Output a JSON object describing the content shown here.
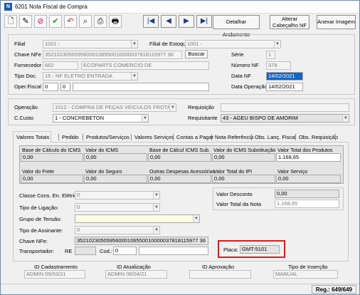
{
  "window": {
    "title": "6201 Nota Fiscal de Compra",
    "icon": "app-icon"
  },
  "toolbar": {
    "icons": [
      "new-icon",
      "edit-icon",
      "cancel-icon",
      "confirm-icon",
      "undo-icon",
      "search-icon",
      "print-icon",
      "printer-icon"
    ],
    "nav": [
      "first",
      "prev",
      "next",
      "last"
    ],
    "detail_label": "Detalhar Andamento",
    "alter_label": "Alterar Cabeçalho NF",
    "image_label": "Anexar Imagem"
  },
  "header": {
    "filial_label": "Filial",
    "filial_value": "1001 -",
    "filial_estoque_label": "Filial de Estoque",
    "filial_estoque_value": "1001 -",
    "chave_label": "Chave NFe",
    "chave_value": "35210230505956000106550010000037818115977 36",
    "buscar_label": "Buscar",
    "serie_label": "Série",
    "serie_value": "1",
    "fornecedor_label": "Fornecedor",
    "fornecedor_code": "662",
    "fornecedor_name": "ECOPARTS COMERCIO DE",
    "numero_label": "Número NF",
    "numero_value": "378",
    "tipo_doc_label": "Tipo Doc.",
    "tipo_doc_value": "15 - NF ELETRO ENTRADA",
    "data_nf_label": "Data NF",
    "data_nf_value": "14/02/2021",
    "oper_label": "Oper.Fiscal",
    "oper_a": "0",
    "oper_b": "0",
    "data_oper_label": "Data Operação",
    "data_oper_value": "14/02/2021"
  },
  "op": {
    "operacao_label": "Operação",
    "operacao_value": "1012 - COMPRA DE PEÇAS VEICULOS FROTA",
    "requisicao_label": "Requisição",
    "ccusto_label": "C.Custo",
    "ccusto_value": "1 - CONCREBETON",
    "requisitante_label": "Requisitante",
    "requisitante_value": "43 - AGEU BISPO DE AMORIM"
  },
  "tabs": [
    "Valores Totais",
    "Pedido",
    "Produtos/Serviços",
    "Valores Serviços",
    "Contas a Pagar",
    "Nota Referência",
    "Obs. Lanç. Fiscal",
    "Obs. Requisição"
  ],
  "totals": {
    "h1": [
      "Base de Cálculo do ICMS",
      "Valor do ICMS",
      "Base de Cálcul ICMS Sub.",
      "Valor do ICMS Substituição",
      "Valor Total dos Produtos"
    ],
    "v1": [
      "0,00",
      "0,00",
      "0,00",
      "0,00",
      "1.168,65"
    ],
    "h2": [
      "Valor do  Frete",
      "Valor do Seguro",
      "Outras Despesas Acessórias",
      "Valor Total do IPI",
      "Valor Serviço"
    ],
    "v2": [
      "0,00",
      "0,00",
      "0,00",
      "0,00",
      "0,00"
    ]
  },
  "extra": {
    "classe_label": "Classe Cons. En. Elétrica:",
    "classe_value": "0",
    "ligacao_label": "Tipo de Ligação:",
    "ligacao_value": "0",
    "tensao_label": "Grupo de Tensão:",
    "tensao_value": "",
    "assinante_label": "Tipo de Assinante:",
    "assinante_value": "0",
    "chave_label": "Chave NFe:",
    "chave_value": "35210230505956000106550010000037818115977 36",
    "transp_label": "Transportador:",
    "re_label": "RE",
    "cod_label": "Cod.:",
    "cod_value": "0",
    "placa_label": "Placa:",
    "placa_value": "GMT-5101",
    "desconto_label": "Valor Desconto",
    "desconto_value": "0,00",
    "total_nota_label": "Valor Total da Nota",
    "total_nota_value": "1.168,65"
  },
  "footer": {
    "cad_label": "ID Cadastramento",
    "cad_value": "ADMIN 09/03/21",
    "atu_label": "ID Atualização",
    "atu_value": "ADMIN 06/04/21",
    "apr_label": "ID Aprovação",
    "apr_value": "",
    "ins_label": "Tipo de Inserção",
    "ins_value": "MANUAL"
  },
  "status": {
    "reg": "Reg.: 649/649"
  },
  "colors": {
    "selection": "#1366c6",
    "highlight_box": "#d42020",
    "yellow_field": "#ffffe1"
  }
}
